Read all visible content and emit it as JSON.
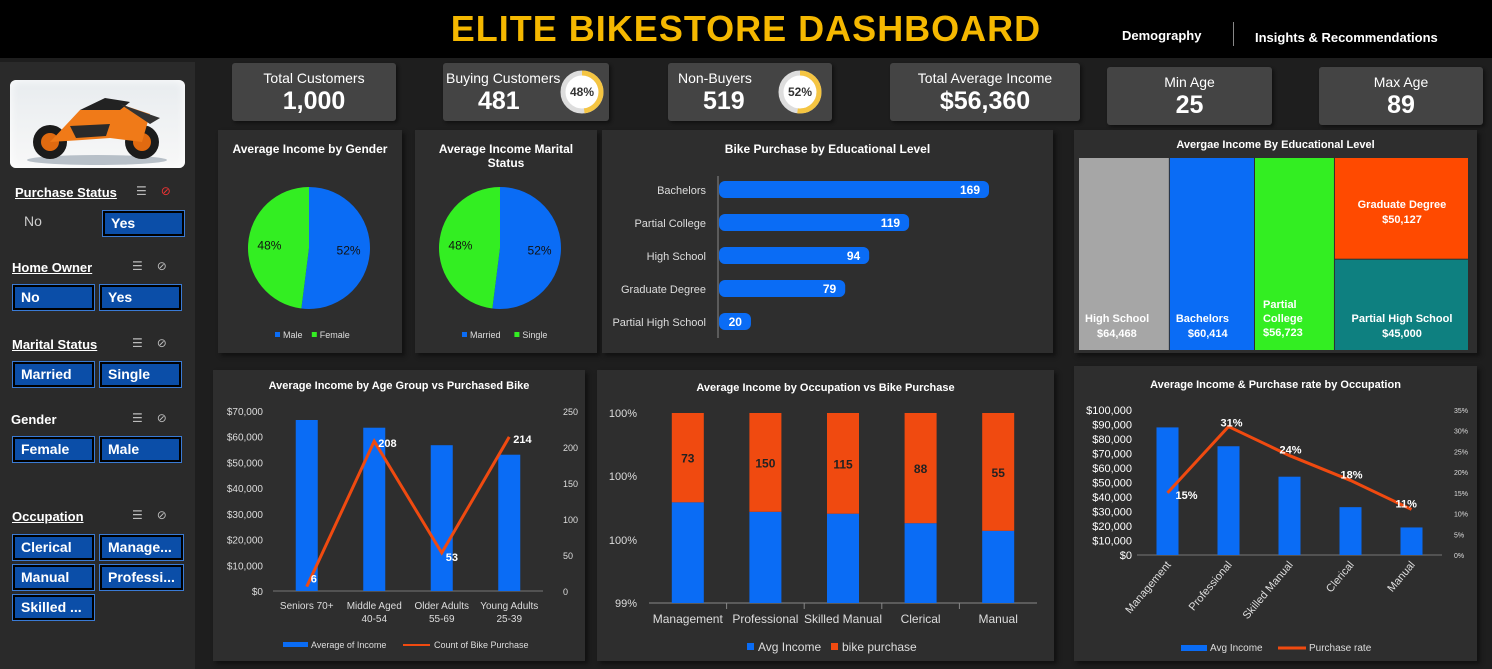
{
  "header": {
    "title": "ELITE BIKESTORE DASHBOARD",
    "nav": [
      "Demography",
      "Insights & Recommendations"
    ]
  },
  "kpis": {
    "total_customers": {
      "label": "Total Customers",
      "value": "1,000"
    },
    "buying_customers": {
      "label": "Buying Customers",
      "value": "481",
      "pct": "48%",
      "fraction": 0.48
    },
    "non_buyers": {
      "label": "Non-Buyers",
      "value": "519",
      "pct": "52%",
      "fraction": 0.52
    },
    "total_avg_income": {
      "label": "Total Average Income",
      "value": "$56,360"
    },
    "min_age": {
      "label": "Min Age",
      "value": "25"
    },
    "max_age": {
      "label": "Max Age",
      "value": "89"
    }
  },
  "slicers": {
    "purchase_status": {
      "title": "Purchase Status",
      "items": [
        "No",
        "Yes"
      ]
    },
    "home_owner": {
      "title": "Home Owner",
      "items": [
        "No",
        "Yes"
      ]
    },
    "marital_status": {
      "title": "Marital Status",
      "items": [
        "Married",
        "Single"
      ]
    },
    "gender": {
      "title": "Gender",
      "items": [
        "Female",
        "Male"
      ]
    },
    "occupation": {
      "title": "Occupation",
      "items": [
        "Clerical",
        "Manage...",
        "Manual",
        "Professi...",
        "Skilled ..."
      ]
    }
  },
  "colors": {
    "blue": "#0a6cf5",
    "green": "#33ee22",
    "orange": "#f04a10",
    "gold": "#f5b800"
  },
  "chart_data": [
    {
      "id": "gender_pie",
      "type": "pie",
      "title": "Average Income by Gender",
      "categories": [
        "Male",
        "Female"
      ],
      "values": [
        52,
        48
      ],
      "labels": [
        "52%",
        "48%"
      ]
    },
    {
      "id": "marital_pie",
      "type": "pie",
      "title": "Average Income Marital Status",
      "categories": [
        "Married",
        "Single"
      ],
      "values": [
        52,
        48
      ],
      "labels": [
        "52%",
        "48%"
      ]
    },
    {
      "id": "edu_bar",
      "type": "bar",
      "title": "Bike Purchase by Educational Level",
      "categories": [
        "Bachelors",
        "Partial College",
        "High School",
        "Graduate Degree",
        "Partial High School"
      ],
      "values": [
        169,
        119,
        94,
        79,
        20
      ]
    },
    {
      "id": "edu_treemap",
      "type": "treemap",
      "title": "Avergae Income By Educational Level",
      "categories": [
        "High School",
        "Bachelors",
        "Partial College",
        "Graduate Degree",
        "Partial High School"
      ],
      "values": [
        64468,
        60414,
        56723,
        50127,
        45000
      ],
      "labels": [
        "$64,468",
        "$60,414",
        "$56,723",
        "$50,127",
        "$45,000"
      ],
      "colors": [
        "#a6a6a6",
        "#0a6cf5",
        "#33ee22",
        "#ff4a00",
        "#0e8080"
      ]
    },
    {
      "id": "age_combo",
      "type": "bar",
      "title": "Average Income by Age Group vs Purchased Bike",
      "categories": [
        "Seniors 70+",
        "Middle Aged 40-54",
        "Older Adults 55-69",
        "Young Adults 25-39"
      ],
      "category_lines": [
        [
          "Seniors 70+"
        ],
        [
          "Middle Aged",
          "40-54"
        ],
        [
          "Older Adults",
          "55-69"
        ],
        [
          "Young Adults",
          "25-39"
        ]
      ],
      "series": [
        {
          "name": "Average of Income",
          "type": "bar",
          "axis": "left",
          "values": [
            66500,
            63500,
            56700,
            53000
          ]
        },
        {
          "name": "Count of Bike Purchase",
          "type": "line",
          "axis": "right",
          "values": [
            6,
            208,
            53,
            214
          ]
        }
      ],
      "ylim": [
        0,
        70000
      ],
      "y2lim": [
        0,
        250
      ],
      "yticks": [
        "$0",
        "$10,000",
        "$20,000",
        "$30,000",
        "$40,000",
        "$50,000",
        "$60,000",
        "$70,000"
      ],
      "y2ticks": [
        "0",
        "50",
        "100",
        "150",
        "200",
        "250"
      ]
    },
    {
      "id": "occ_stack",
      "type": "bar",
      "title": "Average Income by Occupation vs Bike Purchase",
      "categories": [
        "Management",
        "Professional",
        "Skilled Manual",
        "Clerical",
        "Manual"
      ],
      "series": [
        {
          "name": "Avg Income",
          "values": [
            0.9953,
            0.9948,
            0.9947,
            0.9942,
            0.9938
          ]
        },
        {
          "name": "bike purchase",
          "values": [
            73,
            150,
            115,
            88,
            55
          ]
        }
      ],
      "yticks": [
        "100%",
        "100%",
        "100%",
        "99%"
      ]
    },
    {
      "id": "occ_combo",
      "type": "bar",
      "title": "Average Income & Purchase rate by Occupation",
      "categories": [
        "Management",
        "Professional",
        "Skilled Manual",
        "Clerical",
        "Manual"
      ],
      "series": [
        {
          "name": "Avg Income",
          "type": "bar",
          "axis": "left",
          "values": [
            88000,
            75000,
            54000,
            33000,
            19000
          ]
        },
        {
          "name": "Purchase rate",
          "type": "line",
          "axis": "right",
          "values": [
            0.15,
            0.31,
            0.24,
            0.18,
            0.11
          ],
          "labels": [
            "15%",
            "31%",
            "24%",
            "18%",
            "11%"
          ]
        }
      ],
      "ylim": [
        0,
        100000
      ],
      "y2lim": [
        0,
        0.35
      ],
      "yticks": [
        "$0",
        "$10,000",
        "$20,000",
        "$30,000",
        "$40,000",
        "$50,000",
        "$60,000",
        "$70,000",
        "$80,000",
        "$90,000",
        "$100,000"
      ],
      "y2ticks": [
        "0%",
        "5%",
        "10%",
        "15%",
        "20%",
        "25%",
        "30%",
        "35%"
      ]
    }
  ]
}
